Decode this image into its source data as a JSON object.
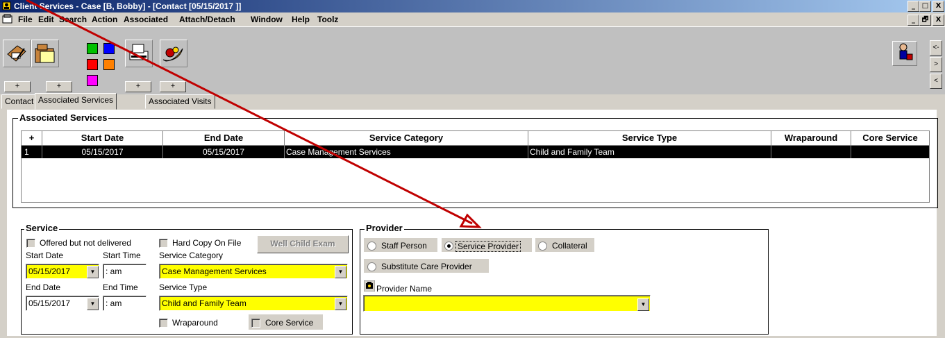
{
  "window": {
    "title": "Client Services - Case [B, Bobby] - [Contact [05/15/2017 ]]",
    "minimize": "_",
    "maximize": "□",
    "close": "X",
    "restore": "🗗"
  },
  "menu": [
    "File",
    "Edit",
    "Search",
    "Action",
    "Associated",
    "Attach/Detach",
    "Window",
    "Help",
    "Toolz"
  ],
  "toolbar": {
    "plus": "+",
    "nav": [
      "<-",
      ">",
      "<"
    ],
    "colors": {
      "green": "#00c000",
      "blue": "#0000ff",
      "red": "#ff0000",
      "orange": "#ff8000",
      "magenta": "#ff00ff"
    }
  },
  "tabs": [
    "Contact",
    "Associated Services",
    "Associated Visits"
  ],
  "associated_services": {
    "label": "Associated Services",
    "columns": [
      "+",
      "Start Date",
      "End Date",
      "Service Category",
      "Service Type",
      "Wraparound",
      "Core Service"
    ],
    "rows": [
      {
        "num": "1",
        "start": "05/15/2017",
        "end": "05/15/2017",
        "category": "Case Management Services",
        "type": "Child and Family Team",
        "wraparound": "",
        "core": ""
      }
    ]
  },
  "service": {
    "label": "Service",
    "offered_not_delivered": "Offered but not delivered",
    "hard_copy": "Hard Copy On File",
    "well_child": "Well Child Exam",
    "start_date_label": "Start Date",
    "start_time_label": "Start Time",
    "start_date": "05/15/2017",
    "start_time": " :  am",
    "category_label": "Service Category",
    "category": "Case Management Services",
    "end_date_label": "End Date",
    "end_time_label": "End Time",
    "end_date": "05/15/2017",
    "end_time": " :  am",
    "type_label": "Service Type",
    "type": "Child and Family Team",
    "wraparound": "Wraparound",
    "core_service": "Core Service"
  },
  "provider": {
    "label": "Provider",
    "staff_person": "Staff Person",
    "service_provider": "Service Provider",
    "collateral": "Collateral",
    "substitute": "Substitute Care Provider",
    "name_label": "Provider Name",
    "name_value": "",
    "selected": "Service Provider"
  },
  "annotation": {
    "color": "#c00000"
  }
}
